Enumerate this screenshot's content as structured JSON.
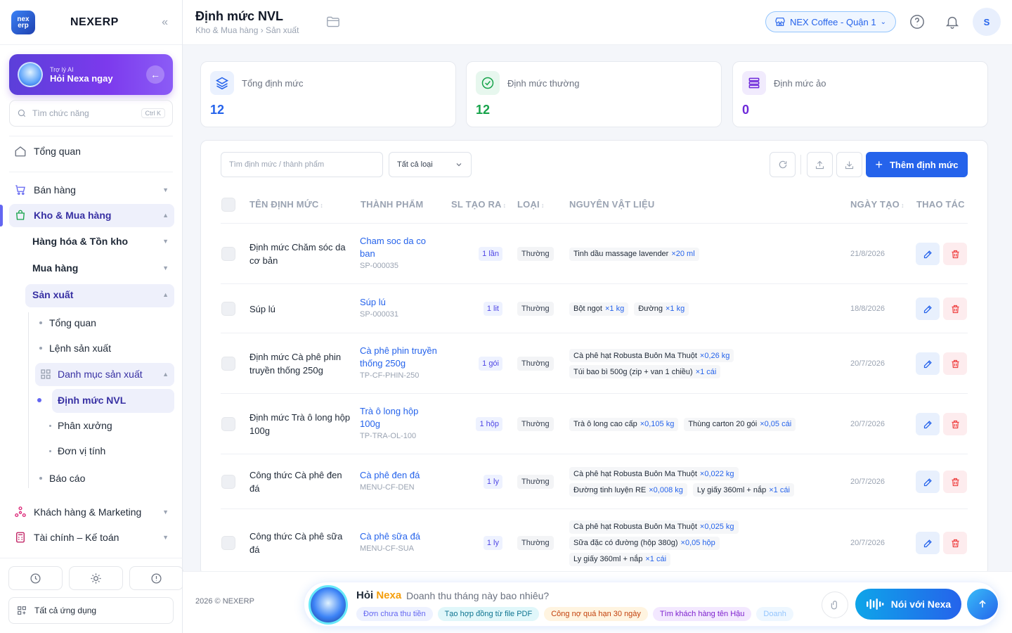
{
  "brand": {
    "logo_text": "nex erp",
    "name": "NEXERP",
    "collapse_icon": "double-chevron-left-icon"
  },
  "ai": {
    "small": "Trợ lý AI",
    "big": "Hỏi Nexa ngay"
  },
  "search_fn": {
    "placeholder": "Tìm chức năng",
    "shortcut": "Ctrl K"
  },
  "menu": {
    "overview": "Tổng quan",
    "sales": "Bán hàng",
    "warehouse": "Kho & Mua hàng",
    "goods": "Hàng hóa & Tồn kho",
    "purchase": "Mua hàng",
    "production": "Sản xuất",
    "prod_overview": "Tổng quan",
    "prod_orders": "Lệnh sản xuất",
    "prod_catalog": "Danh mục sản xuất",
    "bom": "Định mức NVL",
    "workshop": "Phân xưởng",
    "units": "Đơn vị tính",
    "reports": "Báo cáo",
    "customers": "Khách hàng & Marketing",
    "finance": "Tài chính – Kế toán",
    "all_apps": "Tất cả ứng dụng"
  },
  "header": {
    "title": "Định mức NVL",
    "breadcrumb": "Kho & Mua hàng › Sản xuất",
    "store": "NEX Coffee - Quận 1",
    "avatar": "S"
  },
  "stats": [
    {
      "label": "Tổng định mức",
      "value": "12",
      "color": "#2563eb"
    },
    {
      "label": "Định mức thường",
      "value": "12",
      "color": "#16a34a"
    },
    {
      "label": "Định mức ảo",
      "value": "0",
      "color": "#6d28d9"
    }
  ],
  "toolbar": {
    "search_placeholder": "Tìm định mức / thành phẩm",
    "filter_value": "Tất cả loại",
    "add_label": "Thêm định mức"
  },
  "columns": {
    "name": "TÊN ĐỊNH MỨC",
    "product": "THÀNH PHẨM",
    "qty": "SL TẠO RA",
    "type": "LOẠI",
    "materials": "NGUYÊN VẬT LIỆU",
    "date": "NGÀY TẠO",
    "actions": "THAO TÁC"
  },
  "rows": [
    {
      "name": "Định mức Chăm sóc da cơ bản",
      "product": "Cham soc da co ban",
      "code": "SP-000035",
      "qty": "1 lần",
      "type": "Thường",
      "materials": [
        [
          {
            "n": "Tinh dầu massage lavender",
            "q": "×20 ml"
          }
        ]
      ],
      "date": "21/8/2026"
    },
    {
      "name": "Súp lú",
      "product": "Súp lú",
      "code": "SP-000031",
      "qty": "1 lit",
      "type": "Thường",
      "materials": [
        [
          {
            "n": "Bột ngọt",
            "q": "×1 kg"
          },
          {
            "n": "Đường",
            "q": "×1 kg"
          }
        ]
      ],
      "date": "18/8/2026"
    },
    {
      "name": "Định mức Cà phê phin truyền thống 250g",
      "product": "Cà phê phin truyền thống 250g",
      "code": "TP-CF-PHIN-250",
      "qty": "1 gói",
      "type": "Thường",
      "materials": [
        [
          {
            "n": "Cà phê hạt Robusta Buôn Ma Thuột",
            "q": "×0,26 kg"
          }
        ],
        [
          {
            "n": "Túi bao bì 500g (zip + van 1 chiều)",
            "q": "×1 cái"
          }
        ]
      ],
      "date": "20/7/2026"
    },
    {
      "name": "Định mức Trà ô long hộp 100g",
      "product": "Trà ô long hộp 100g",
      "code": "TP-TRA-OL-100",
      "qty": "1 hộp",
      "type": "Thường",
      "materials": [
        [
          {
            "n": "Trà ô long cao cấp",
            "q": "×0,105 kg"
          },
          {
            "n": "Thùng carton 20 gói",
            "q": "×0,05 cái"
          }
        ]
      ],
      "date": "20/7/2026"
    },
    {
      "name": "Công thức Cà phê đen đá",
      "product": "Cà phê đen đá",
      "code": "MENU-CF-DEN",
      "qty": "1 ly",
      "type": "Thường",
      "materials": [
        [
          {
            "n": "Cà phê hạt Robusta Buôn Ma Thuột",
            "q": "×0,022 kg"
          }
        ],
        [
          {
            "n": "Đường tinh luyện RE",
            "q": "×0,008 kg"
          },
          {
            "n": "Ly giấy 360ml + nắp",
            "q": "×1 cái"
          }
        ]
      ],
      "date": "20/7/2026"
    },
    {
      "name": "Công thức Cà phê sữa đá",
      "product": "Cà phê sữa đá",
      "code": "MENU-CF-SUA",
      "qty": "1 ly",
      "type": "Thường",
      "materials": [
        [
          {
            "n": "Cà phê hạt Robusta Buôn Ma Thuột",
            "q": "×0,025 kg"
          }
        ],
        [
          {
            "n": "Sữa đặc có đường (hộp 380g)",
            "q": "×0,05 hộp"
          }
        ],
        [
          {
            "n": "Ly giấy 360ml + nắp",
            "q": "×1 cái"
          }
        ]
      ],
      "date": "20/7/2026"
    }
  ],
  "footer": {
    "copyright": "2026 © NEXERP",
    "nexa_prefix": "Hỏi",
    "nexa_name": "Nexa",
    "question": "Doanh thu tháng này bao nhiêu?",
    "chips": [
      {
        "label": "Đơn chưa thu tiền",
        "bg": "#eef2ff",
        "fg": "#6366f1"
      },
      {
        "label": "Tạo hợp đồng từ file PDF",
        "bg": "#e0f7fa",
        "fg": "#0e7490"
      },
      {
        "label": "Công nợ quá hạn 30 ngày",
        "bg": "#fff4e0",
        "fg": "#c2410c"
      },
      {
        "label": "Tìm khách hàng tên Hậu",
        "bg": "#f3e8ff",
        "fg": "#7e22ce"
      },
      {
        "label": "Doanh",
        "bg": "#eef7ff",
        "fg": "#93c5fd"
      }
    ],
    "talk_label": "Nói với Nexa"
  }
}
